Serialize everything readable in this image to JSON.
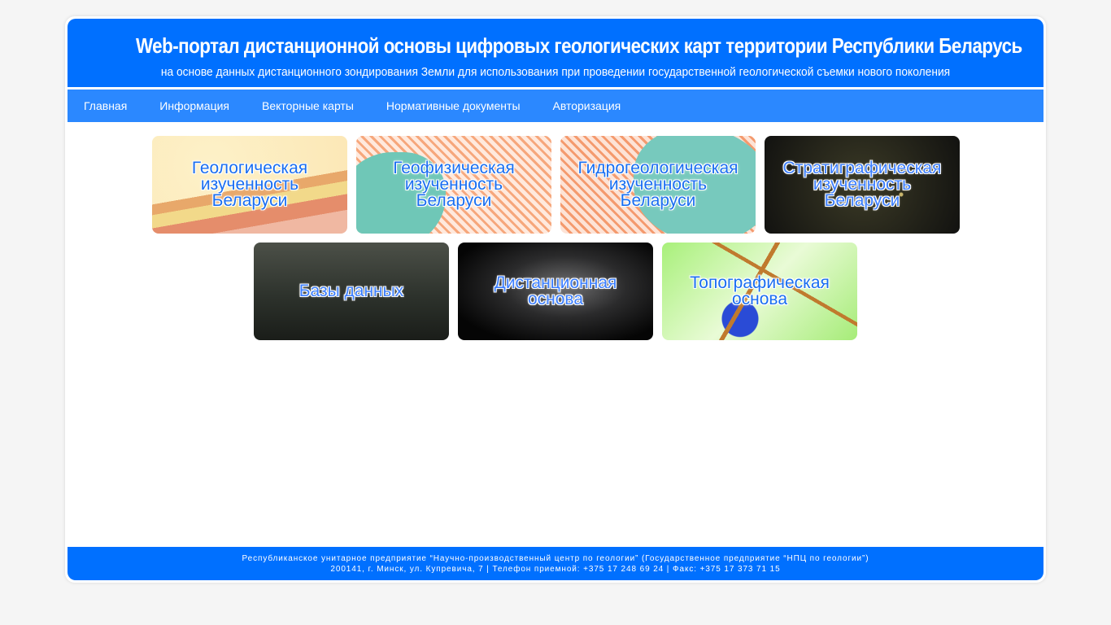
{
  "header": {
    "title": "Web-портал дистанционной основы цифровых геологических карт территории Республики Беларусь",
    "subtitle": "на основе данных дистанционного зондирования Земли для использования при проведении государственной геологической съемки нового поколения"
  },
  "nav": {
    "items": [
      {
        "label": "Главная"
      },
      {
        "label": "Информация"
      },
      {
        "label": "Векторные карты"
      },
      {
        "label": "Нормативные документы"
      },
      {
        "label": "Авторизация"
      }
    ]
  },
  "tiles": [
    {
      "label": "Геологическая\nизученность\nБеларуси"
    },
    {
      "label": "Геофизическая\nизученность\nБеларуси"
    },
    {
      "label": "Гидрогеологическая\nизученность\nБеларуси"
    },
    {
      "label": "Стратиграфическая\nизученность\nБеларуси"
    },
    {
      "label": "Базы данных"
    },
    {
      "label": "Дистанционная\nоснова"
    },
    {
      "label": "Топографическая\nоснова"
    }
  ],
  "footer": {
    "line1": "Республиканское унитарное предприятие “Научно-производственный центр по геологии” (Государственное предприятие “НПЦ по геологии”)",
    "line2": "200141, г. Минск, ул. Купревича, 7 | Телефон приемной: +375 17 248 69 24 | Факс: +375 17 373 71 15"
  }
}
